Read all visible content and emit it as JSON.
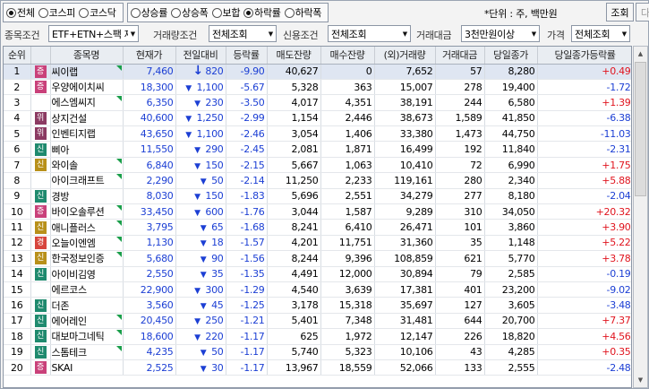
{
  "market_radios": [
    {
      "label": "전체",
      "checked": true
    },
    {
      "label": "코스피",
      "checked": false
    },
    {
      "label": "코스닥",
      "checked": false
    }
  ],
  "rank_radios": [
    {
      "label": "상승률",
      "checked": false
    },
    {
      "label": "상승폭",
      "checked": false
    },
    {
      "label": "보합",
      "checked": false
    },
    {
      "label": "하락률",
      "checked": true
    },
    {
      "label": "하락폭",
      "checked": false
    }
  ],
  "unit_text": "*단위 : 주, 백만원",
  "buttons": {
    "search": "조회",
    "next": "다음"
  },
  "filters": {
    "item_condition_label": "종목조건",
    "item_condition_value": "ETF+ETN+스팩 제외",
    "volume_condition_label": "거래량조건",
    "volume_condition_value": "전체조회",
    "credit_condition_label": "신용조건",
    "credit_condition_value": "전체조회",
    "amount_label": "거래대금",
    "amount_value": "3천만원이상",
    "price_label": "가격",
    "price_value": "전체조회"
  },
  "colors": {
    "up": "#e0141e",
    "down": "#1c3fd4",
    "badge_jeung": "#c9417a",
    "badge_wi": "#8b3a62",
    "badge_sin": "#1f8a6e",
    "badge_gwan": "#d7453d",
    "badge_bal": "#b8901a"
  },
  "table": {
    "headers": [
      "순위",
      "",
      "종목명",
      "현재가",
      "전일대비",
      "등락률",
      "매도잔량",
      "매수잔량",
      "(외)거래량",
      "거래대금",
      "당일종가",
      "당일종가등락률"
    ],
    "rows": [
      {
        "rank": "1",
        "badge": "증",
        "badge_type": "jeung",
        "name": "씨이랩",
        "price": "7,460",
        "arrow": "limitdown",
        "change": "820",
        "rate": "-9.90",
        "ask": "40,627",
        "bid": "0",
        "volume": "7,652",
        "amount": "57",
        "close": "8,280",
        "close_rate": "+0.49",
        "close_dir": "up",
        "flag": true
      },
      {
        "rank": "2",
        "badge": "증",
        "badge_type": "jeung",
        "name": "우양에이치씨",
        "price": "18,300",
        "arrow": "down",
        "change": "1,100",
        "rate": "-5.67",
        "ask": "5,328",
        "bid": "363",
        "volume": "15,007",
        "amount": "278",
        "close": "19,400",
        "close_rate": "-1.72",
        "close_dir": "dn",
        "flag": false
      },
      {
        "rank": "3",
        "badge": "",
        "badge_type": "",
        "name": "에스엠씨지",
        "price": "6,350",
        "arrow": "down",
        "change": "230",
        "rate": "-3.50",
        "ask": "4,017",
        "bid": "4,351",
        "volume": "38,191",
        "amount": "244",
        "close": "6,580",
        "close_rate": "+1.39",
        "close_dir": "up",
        "flag": true
      },
      {
        "rank": "4",
        "badge": "위",
        "badge_type": "wi",
        "name": "상지건설",
        "price": "40,600",
        "arrow": "down",
        "change": "1,250",
        "rate": "-2.99",
        "ask": "1,154",
        "bid": "2,446",
        "volume": "38,673",
        "amount": "1,589",
        "close": "41,850",
        "close_rate": "-6.38",
        "close_dir": "dn",
        "flag": false
      },
      {
        "rank": "5",
        "badge": "위",
        "badge_type": "wi",
        "name": "인벤티지랩",
        "price": "43,650",
        "arrow": "down",
        "change": "1,100",
        "rate": "-2.46",
        "ask": "3,054",
        "bid": "1,406",
        "volume": "33,380",
        "amount": "1,473",
        "close": "44,750",
        "close_rate": "-11.03",
        "close_dir": "dn",
        "flag": false
      },
      {
        "rank": "6",
        "badge": "신",
        "badge_type": "sin",
        "name": "삐아",
        "price": "11,550",
        "arrow": "down",
        "change": "290",
        "rate": "-2.45",
        "ask": "2,081",
        "bid": "1,871",
        "volume": "16,499",
        "amount": "192",
        "close": "11,840",
        "close_rate": "-2.31",
        "close_dir": "dn",
        "flag": false
      },
      {
        "rank": "7",
        "badge": "신",
        "badge_type": "bal",
        "name": "와이솔",
        "price": "6,840",
        "arrow": "down",
        "change": "150",
        "rate": "-2.15",
        "ask": "5,667",
        "bid": "1,063",
        "volume": "10,410",
        "amount": "72",
        "close": "6,990",
        "close_rate": "+1.75",
        "close_dir": "up",
        "flag": true
      },
      {
        "rank": "8",
        "badge": "",
        "badge_type": "",
        "name": "아이크래프트",
        "price": "2,290",
        "arrow": "down",
        "change": "50",
        "rate": "-2.14",
        "ask": "11,250",
        "bid": "2,233",
        "volume": "119,161",
        "amount": "280",
        "close": "2,340",
        "close_rate": "+5.88",
        "close_dir": "up",
        "flag": true
      },
      {
        "rank": "9",
        "badge": "신",
        "badge_type": "sin",
        "name": "경방",
        "price": "8,030",
        "arrow": "down",
        "change": "150",
        "rate": "-1.83",
        "ask": "5,696",
        "bid": "2,551",
        "volume": "34,279",
        "amount": "277",
        "close": "8,180",
        "close_rate": "-2.04",
        "close_dir": "dn",
        "flag": false
      },
      {
        "rank": "10",
        "badge": "증",
        "badge_type": "jeung",
        "name": "바이오솔루션",
        "price": "33,450",
        "arrow": "down",
        "change": "600",
        "rate": "-1.76",
        "ask": "3,044",
        "bid": "1,587",
        "volume": "9,289",
        "amount": "310",
        "close": "34,050",
        "close_rate": "+20.32",
        "close_dir": "up",
        "flag": true
      },
      {
        "rank": "11",
        "badge": "신",
        "badge_type": "bal",
        "name": "애니플러스",
        "price": "3,795",
        "arrow": "down",
        "change": "65",
        "rate": "-1.68",
        "ask": "8,241",
        "bid": "6,410",
        "volume": "26,471",
        "amount": "101",
        "close": "3,860",
        "close_rate": "+3.90",
        "close_dir": "up",
        "flag": true
      },
      {
        "rank": "12",
        "badge": "경",
        "badge_type": "gwan",
        "name": "오늘이엔엠",
        "price": "1,130",
        "arrow": "down",
        "change": "18",
        "rate": "-1.57",
        "ask": "4,201",
        "bid": "11,751",
        "volume": "31,360",
        "amount": "35",
        "close": "1,148",
        "close_rate": "+5.22",
        "close_dir": "up",
        "flag": true
      },
      {
        "rank": "13",
        "badge": "신",
        "badge_type": "bal",
        "name": "한국정보인증",
        "price": "5,680",
        "arrow": "down",
        "change": "90",
        "rate": "-1.56",
        "ask": "8,244",
        "bid": "9,396",
        "volume": "108,859",
        "amount": "621",
        "close": "5,770",
        "close_rate": "+3.78",
        "close_dir": "up",
        "flag": true
      },
      {
        "rank": "14",
        "badge": "신",
        "badge_type": "sin",
        "name": "아이비김영",
        "price": "2,550",
        "arrow": "down",
        "change": "35",
        "rate": "-1.35",
        "ask": "4,491",
        "bid": "12,000",
        "volume": "30,894",
        "amount": "79",
        "close": "2,585",
        "close_rate": "-0.19",
        "close_dir": "dn",
        "flag": false
      },
      {
        "rank": "15",
        "badge": "",
        "badge_type": "",
        "name": "에르코스",
        "price": "22,900",
        "arrow": "down",
        "change": "300",
        "rate": "-1.29",
        "ask": "4,540",
        "bid": "3,639",
        "volume": "17,381",
        "amount": "401",
        "close": "23,200",
        "close_rate": "-9.02",
        "close_dir": "dn",
        "flag": false
      },
      {
        "rank": "16",
        "badge": "신",
        "badge_type": "sin",
        "name": "더존",
        "price": "3,560",
        "arrow": "down",
        "change": "45",
        "rate": "-1.25",
        "ask": "3,178",
        "bid": "15,318",
        "volume": "35,697",
        "amount": "127",
        "close": "3,605",
        "close_rate": "-3.48",
        "close_dir": "dn",
        "flag": false
      },
      {
        "rank": "17",
        "badge": "신",
        "badge_type": "sin",
        "name": "에어레인",
        "price": "20,450",
        "arrow": "down",
        "change": "250",
        "rate": "-1.21",
        "ask": "5,401",
        "bid": "7,348",
        "volume": "31,481",
        "amount": "644",
        "close": "20,700",
        "close_rate": "+7.37",
        "close_dir": "up",
        "flag": true
      },
      {
        "rank": "18",
        "badge": "신",
        "badge_type": "sin",
        "name": "대보마그네틱",
        "price": "18,600",
        "arrow": "down",
        "change": "220",
        "rate": "-1.17",
        "ask": "625",
        "bid": "1,972",
        "volume": "12,147",
        "amount": "226",
        "close": "18,820",
        "close_rate": "+4.56",
        "close_dir": "up",
        "flag": true
      },
      {
        "rank": "19",
        "badge": "신",
        "badge_type": "sin",
        "name": "스톰테크",
        "price": "4,235",
        "arrow": "down",
        "change": "50",
        "rate": "-1.17",
        "ask": "5,740",
        "bid": "5,323",
        "volume": "10,106",
        "amount": "43",
        "close": "4,285",
        "close_rate": "+0.35",
        "close_dir": "up",
        "flag": true
      },
      {
        "rank": "20",
        "badge": "증",
        "badge_type": "jeung",
        "name": "SKAI",
        "price": "2,525",
        "arrow": "down",
        "change": "30",
        "rate": "-1.17",
        "ask": "13,967",
        "bid": "18,559",
        "volume": "52,066",
        "amount": "133",
        "close": "2,555",
        "close_rate": "-2.48",
        "close_dir": "dn",
        "flag": false
      }
    ]
  }
}
